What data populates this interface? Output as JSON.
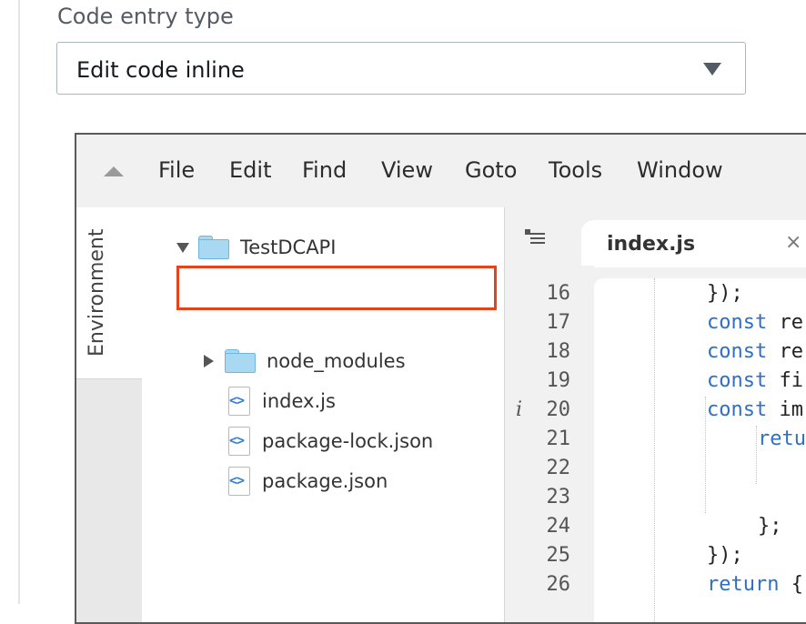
{
  "field": {
    "label": "Code entry type",
    "selected": "Edit code inline"
  },
  "ide": {
    "menu": [
      "File",
      "Edit",
      "Find",
      "View",
      "Goto",
      "Tools",
      "Window"
    ],
    "side_tab": "Environment",
    "tree": {
      "root": "TestDCAPI",
      "items": [
        {
          "label": "node_modules",
          "type": "folder",
          "expanded": false,
          "highlighted": true
        },
        {
          "label": "index.js",
          "type": "file"
        },
        {
          "label": "package-lock.json",
          "type": "file"
        },
        {
          "label": "package.json",
          "type": "file"
        }
      ]
    },
    "editor": {
      "active_tab": "index.js",
      "close_glyph": "×",
      "file_icon_glyph": "<>",
      "info_marker": "i",
      "lines": [
        {
          "num": "16",
          "code": "});"
        },
        {
          "num": "17",
          "kw": "const",
          "code": " re"
        },
        {
          "num": "18",
          "kw": "const",
          "code": " re"
        },
        {
          "num": "19",
          "kw": "const",
          "code": " fi"
        },
        {
          "num": "20",
          "kw": "const",
          "code": " im"
        },
        {
          "num": "21",
          "kw": "retu",
          "code": ""
        },
        {
          "num": "22",
          "code": ""
        },
        {
          "num": "23",
          "code": ""
        },
        {
          "num": "24",
          "code": "};"
        },
        {
          "num": "25",
          "code": "});"
        },
        {
          "num": "26",
          "kw": "return",
          "code": " {"
        }
      ]
    },
    "colors": {
      "highlight": "#e9421b",
      "keyword": "#2f6fc6",
      "folder": "#a9d8f2"
    }
  }
}
